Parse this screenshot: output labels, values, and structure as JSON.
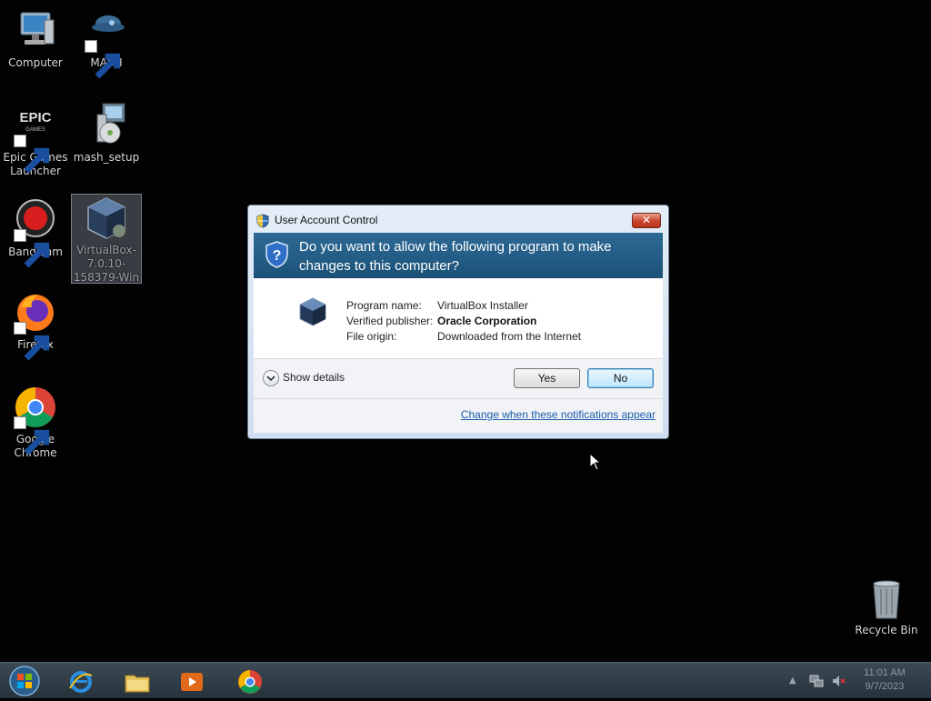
{
  "desktop": {
    "icons": [
      {
        "label": "Computer",
        "icon": "computer-icon"
      },
      {
        "label": "MASH",
        "icon": "mash-icon"
      },
      {
        "label": "Epic Games Launcher",
        "icon": "epic-games-icon"
      },
      {
        "label": "mash_setup",
        "icon": "installer-icon"
      },
      {
        "label": "Bandicam",
        "icon": "bandicam-icon"
      },
      {
        "label": "VirtualBox-7.0.10-158379-Win",
        "icon": "virtualbox-icon"
      },
      {
        "label": "Firefox",
        "icon": "firefox-icon"
      },
      {
        "label": "Google Chrome",
        "icon": "chrome-icon"
      },
      {
        "label": "Recycle Bin",
        "icon": "recycle-bin-icon"
      }
    ]
  },
  "uac": {
    "title": "User Account Control",
    "close_label": "✕",
    "question": "Do you want to allow the following program to make changes to this computer?",
    "program_name_label": "Program name:",
    "program_name_value": "VirtualBox Installer",
    "publisher_label": "Verified publisher:",
    "publisher_value": "Oracle Corporation",
    "origin_label": "File origin:",
    "origin_value": "Downloaded from the Internet",
    "show_details": "Show details",
    "yes_label": "Yes",
    "no_label": "No",
    "change_link": "Change when these notifications appear"
  },
  "taskbar": {
    "items": [
      "start-orb",
      "internet-explorer",
      "file-explorer",
      "media-player",
      "chrome"
    ],
    "tray_arrow": "▲",
    "time": "11:01 AM",
    "date": "9/7/2023"
  },
  "colors": {
    "header_blue": "#1c5278",
    "link": "#1a5dad",
    "close_red": "#c8442a"
  }
}
